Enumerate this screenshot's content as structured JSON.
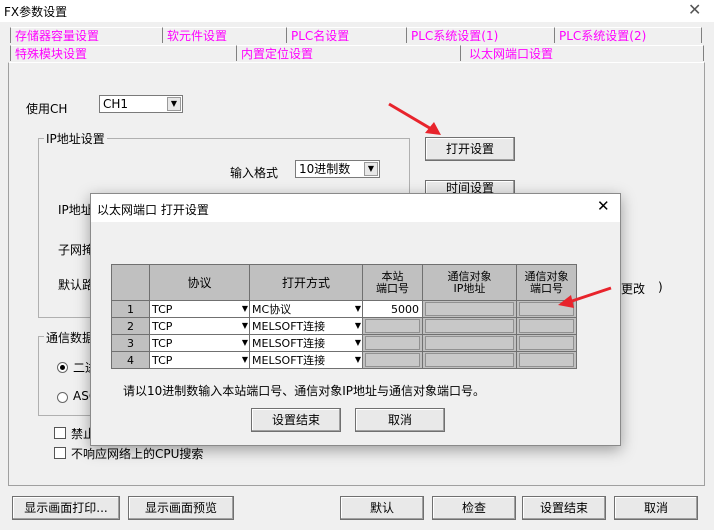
{
  "window": {
    "title": "FX参数设置",
    "close_glyph": "✕"
  },
  "tabs_row1": [
    "存储器容量设置",
    "软元件设置",
    "PLC名设置",
    "PLC系统设置(1)",
    "PLC系统设置(2)"
  ],
  "tabs_row2": [
    "特殊模块设置",
    "内置定位设置",
    "以太网端口设置"
  ],
  "panel": {
    "use_ch_label": "使用CH",
    "use_ch_value": "CH1",
    "ip_group_title": "IP地址设置",
    "input_format_label": "输入格式",
    "input_format_value": "10进制数",
    "ip_label": "IP地址",
    "subnet_label": "子网掩",
    "gateway_label": "默认路",
    "comm_group_title": "通信数据",
    "radio_binary": "二进",
    "radio_ascii": "ASC",
    "check_forbid": "禁止",
    "check_no_cpu_search": "不响应网络上的CPU搜索",
    "open_settings_btn": "打开设置",
    "time_settings_btn": "时间设置",
    "change_text": "更改",
    "paren": ")"
  },
  "bottom_buttons": {
    "print": "显示画面打印...",
    "preview": "显示画面预览",
    "default": "默认",
    "check": "检查",
    "finish": "设置结束",
    "cancel": "取消"
  },
  "modal": {
    "title": "以太网端口 打开设置",
    "close_glyph": "✕",
    "columns": [
      "协议",
      "打开方式",
      "本站\n端口号",
      "通信对象\nIP地址",
      "通信对象\n端口号"
    ],
    "rows": [
      {
        "n": "1",
        "protocol": "TCP",
        "method": "MC协议",
        "port": "5000"
      },
      {
        "n": "2",
        "protocol": "TCP",
        "method": "MELSOFT连接",
        "port": ""
      },
      {
        "n": "3",
        "protocol": "TCP",
        "method": "MELSOFT连接",
        "port": ""
      },
      {
        "n": "4",
        "protocol": "TCP",
        "method": "MELSOFT连接",
        "port": ""
      }
    ],
    "hint": "请以10进制数输入本站端口号、通信对象IP地址与通信对象端口号。",
    "finish_btn": "设置结束",
    "cancel_btn": "取消"
  },
  "colors": {
    "tab_text": "#ff00ff",
    "arrow": "#e8242c"
  }
}
